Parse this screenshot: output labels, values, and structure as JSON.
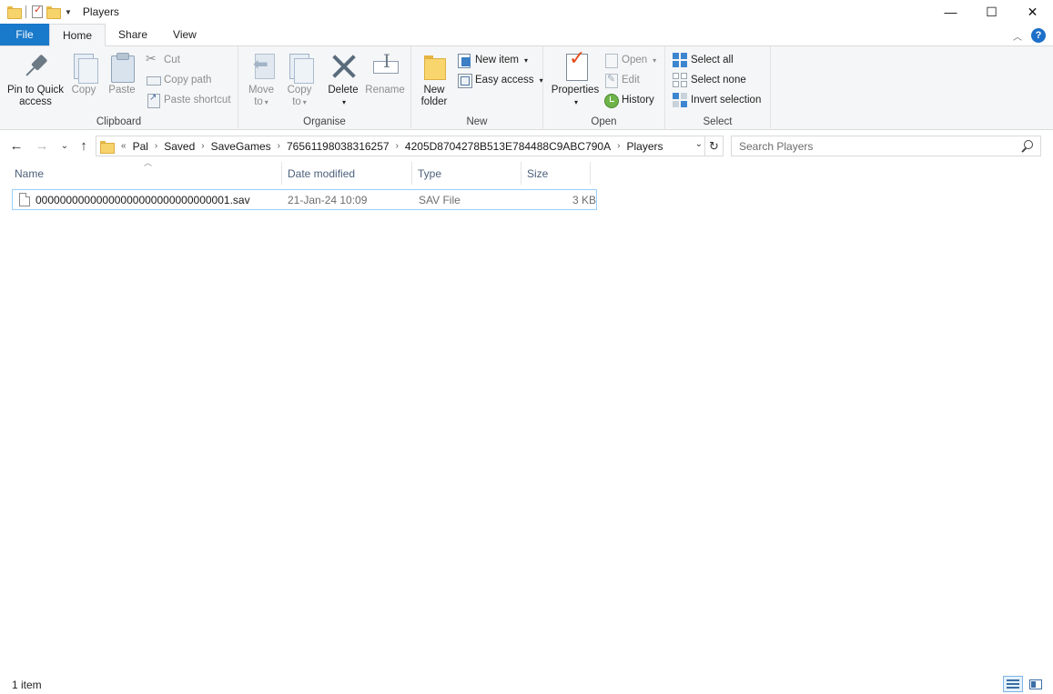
{
  "window": {
    "title": "Players",
    "controls": {
      "minimize": "—",
      "maximize": "☐",
      "close": "✕"
    }
  },
  "tabs": [
    {
      "label": "File"
    },
    {
      "label": "Home"
    },
    {
      "label": "Share"
    },
    {
      "label": "View"
    }
  ],
  "ribbon": {
    "clipboard": {
      "label": "Clipboard",
      "pin": "Pin to Quick access",
      "pin_line1": "Pin to Quick",
      "pin_line2": "access",
      "copy": "Copy",
      "paste": "Paste",
      "cut": "Cut",
      "copy_path": "Copy path",
      "paste_shortcut": "Paste shortcut"
    },
    "organise": {
      "label": "Organise",
      "move_line1": "Move",
      "move_line2": "to",
      "copy_line1": "Copy",
      "copy_line2": "to",
      "delete": "Delete",
      "rename": "Rename"
    },
    "new": {
      "label": "New",
      "new_folder_line1": "New",
      "new_folder_line2": "folder",
      "new_item": "New item",
      "easy_access": "Easy access"
    },
    "open": {
      "label": "Open",
      "properties": "Properties",
      "open": "Open",
      "edit": "Edit",
      "history": "History"
    },
    "select": {
      "label": "Select",
      "select_all": "Select all",
      "select_none": "Select none",
      "invert_selection": "Invert selection"
    }
  },
  "address": {
    "overflow": "«",
    "crumbs": [
      "Pal",
      "Saved",
      "SaveGames",
      "76561198038316257",
      "4205D8704278B513E784488C9ABC790A",
      "Players"
    ]
  },
  "search": {
    "placeholder": "Search Players"
  },
  "columns": {
    "name": "Name",
    "date": "Date modified",
    "type": "Type",
    "size": "Size"
  },
  "files": [
    {
      "name": "00000000000000000000000000000001.sav",
      "date": "21-Jan-24 10:09",
      "type": "SAV File",
      "size": "3 KB"
    }
  ],
  "status": {
    "count": "1 item"
  },
  "colors": {
    "file_tab": "#1979ca",
    "selection_border": "#99d1ff",
    "ribbon_bg": "#f5f6f7"
  }
}
